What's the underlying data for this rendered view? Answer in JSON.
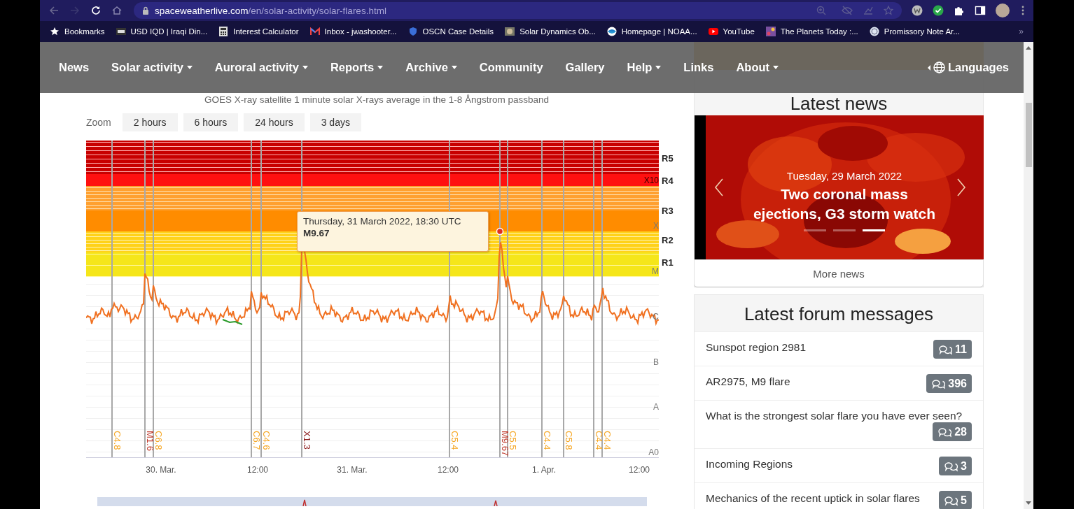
{
  "browser": {
    "url_host": "spaceweatherlive.com",
    "url_path": "/en/solar-activity/solar-flares.html"
  },
  "bookmarks": [
    {
      "label": "Bookmarks",
      "kind": "star"
    },
    {
      "label": "USD IQD | Iraqi Din...",
      "kind": "square"
    },
    {
      "label": "Interest Calculator",
      "kind": "calculator"
    },
    {
      "label": "Inbox - jwashooter...",
      "kind": "mail"
    },
    {
      "label": "OSCN Case Details",
      "kind": "shield"
    },
    {
      "label": "Solar Dynamics Ob..."
    },
    {
      "label": "Homepage | NOAA...",
      "kind": "emblem"
    },
    {
      "label": "YouTube",
      "kind": "play"
    },
    {
      "label": "The Planets Today :...",
      "kind": "planet"
    },
    {
      "label": "Promissory Note Ar...",
      "kind": "seal"
    }
  ],
  "bookmarks_more": "»",
  "nav": [
    {
      "label": "News",
      "dropdown": false
    },
    {
      "label": "Solar activity",
      "dropdown": true
    },
    {
      "label": "Auroral activity",
      "dropdown": true
    },
    {
      "label": "Reports",
      "dropdown": true
    },
    {
      "label": "Archive",
      "dropdown": true
    },
    {
      "label": "Community",
      "dropdown": false
    },
    {
      "label": "Gallery",
      "dropdown": false
    },
    {
      "label": "Help",
      "dropdown": true
    },
    {
      "label": "Links",
      "dropdown": false
    },
    {
      "label": "About",
      "dropdown": true
    }
  ],
  "languages": "Languages",
  "subtitle": "GOES X-ray satellite 1 minute solar X-rays average in the 1-8 Ångstrom passband",
  "zoom": {
    "label": "Zoom",
    "options": [
      {
        "label": "2 hours",
        "selected": false
      },
      {
        "label": "6 hours",
        "selected": false
      },
      {
        "label": "24 hours",
        "selected": false
      },
      {
        "label": "3 days",
        "selected": false
      }
    ]
  },
  "chart": {
    "y_labels": [
      "X10",
      "X",
      "M",
      "C",
      "B",
      "A",
      "A0"
    ],
    "r_labels": [
      "R5",
      "R4",
      "R3",
      "R2",
      "R1"
    ],
    "x_labels": [
      "30. Mar.",
      "12:00",
      "31. Mar.",
      "12:00",
      "1. Apr.",
      "12:00"
    ],
    "flares": [
      {
        "label": "C4.8",
        "kind": "c"
      },
      {
        "label": "M1.6",
        "kind": "m"
      },
      {
        "label": "C6.8",
        "kind": "c"
      },
      {
        "label": "C6.7",
        "kind": "c"
      },
      {
        "label": "C4.6",
        "kind": "c"
      },
      {
        "label": "X1.3",
        "kind": "x"
      },
      {
        "label": "C5.4",
        "kind": "c"
      },
      {
        "label": "M9.67",
        "kind": "m"
      },
      {
        "label": "C5.5",
        "kind": "c"
      },
      {
        "label": "C4.4",
        "kind": "c"
      },
      {
        "label": "C5.8",
        "kind": "c"
      },
      {
        "label": "C4.4",
        "kind": "c"
      },
      {
        "label": "C4.4",
        "kind": "c"
      }
    ],
    "tooltip": {
      "date": "Thursday, 31 March 2022, 18:30 UTC",
      "value": "M9.67"
    }
  },
  "news": {
    "title": "Latest news",
    "date": "Tuesday, 29 March 2022",
    "headline": "Two coronal mass ejections, G3 storm watch",
    "slides": [
      {
        "selected": false
      },
      {
        "selected": false
      },
      {
        "selected": true
      }
    ],
    "more": "More news"
  },
  "forum": {
    "title": "Latest forum messages",
    "topics": [
      {
        "title": "Sunspot region 2981",
        "count": "11"
      },
      {
        "title": "AR2975, M9 flare",
        "count": "396"
      },
      {
        "title": "What is the strongest solar flare you have ever seen?",
        "count": "28"
      },
      {
        "title": "Incoming Regions",
        "count": "3"
      },
      {
        "title": "Mechanics of the recent uptick in solar flares",
        "count": "5"
      }
    ]
  }
}
